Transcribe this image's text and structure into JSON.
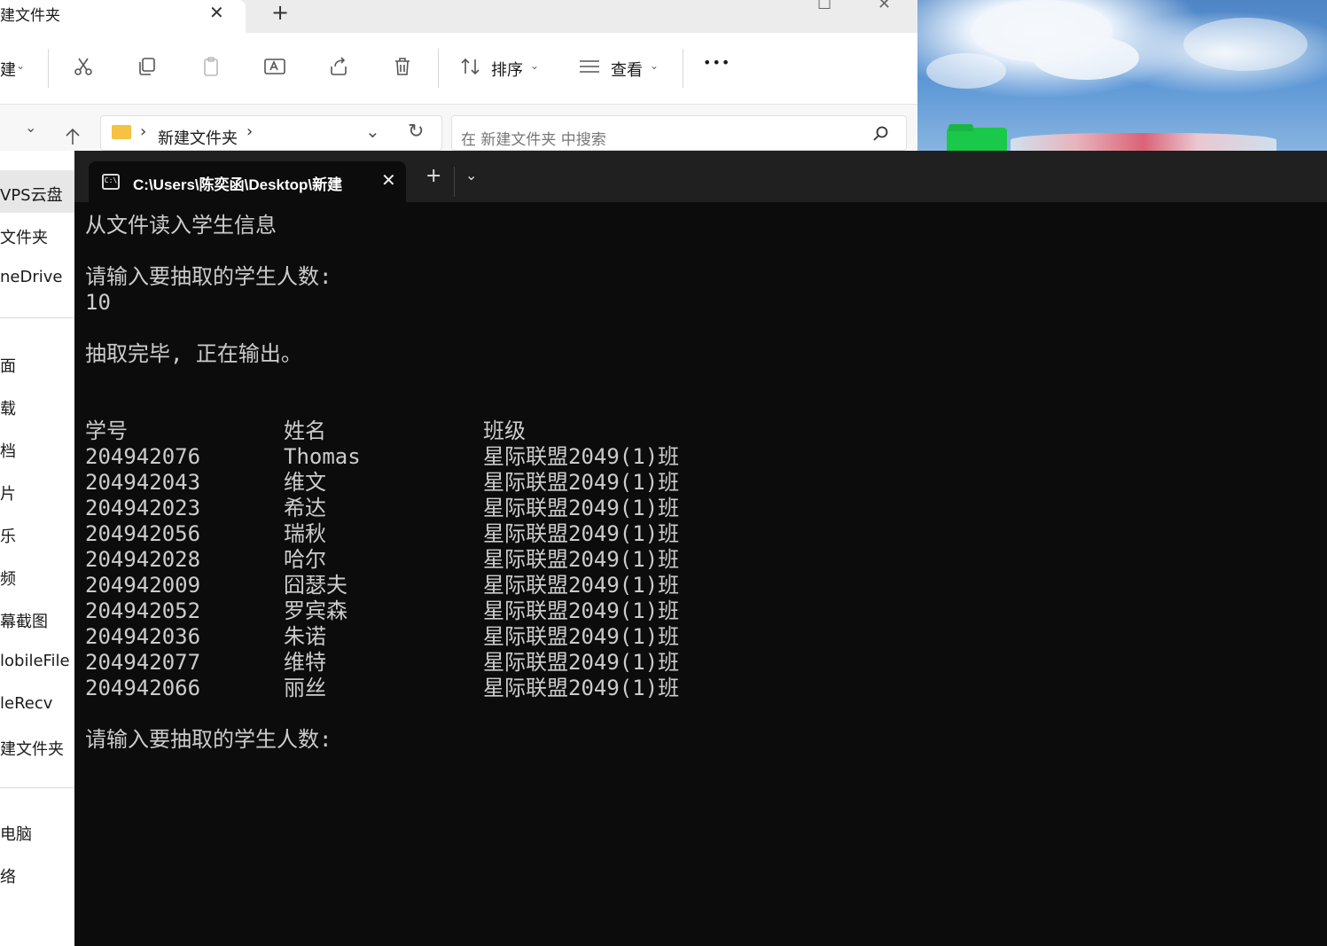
{
  "explorer": {
    "tab_title": "建文件夹",
    "tab_close": "✕",
    "new_tab": "+",
    "toolbar": {
      "new_label": "建",
      "sort_label": "排序",
      "view_label": "查看",
      "more_label": "•••"
    },
    "address": {
      "path_segment": "新建文件夹",
      "separator_1": "›",
      "separator_2": "›"
    },
    "search": {
      "placeholder": "在 新建文件夹 中搜索"
    },
    "sidebar": {
      "items": [
        "VPS云盘",
        "文件夹",
        "neDrive",
        "面",
        "载",
        "档",
        "片",
        "乐",
        "频",
        "幕截图",
        "lobileFile",
        "leRecv",
        "建文件夹",
        "电脑",
        "络"
      ]
    }
  },
  "terminal": {
    "tab_title": "C:\\Users\\陈奕函\\Desktop\\新建",
    "tab_close": "✕",
    "new_tab": "+",
    "dropdown": "⌄",
    "output": {
      "line1": "从文件读入学生信息",
      "prompt1": "请输入要抽取的学生人数:",
      "input1": "10",
      "done": "抽取完毕, 正在输出。",
      "headers": [
        "学号",
        "姓名",
        "班级"
      ],
      "rows": [
        [
          "204942076",
          "Thomas",
          "星际联盟2049(1)班"
        ],
        [
          "204942043",
          "维文",
          "星际联盟2049(1)班"
        ],
        [
          "204942023",
          "希达",
          "星际联盟2049(1)班"
        ],
        [
          "204942056",
          "瑞秋",
          "星际联盟2049(1)班"
        ],
        [
          "204942028",
          "哈尔",
          "星际联盟2049(1)班"
        ],
        [
          "204942009",
          "囧瑟夫",
          "星际联盟2049(1)班"
        ],
        [
          "204942052",
          "罗宾森",
          "星际联盟2049(1)班"
        ],
        [
          "204942036",
          "朱诺",
          "星际联盟2049(1)班"
        ],
        [
          "204942077",
          "维特",
          "星际联盟2049(1)班"
        ],
        [
          "204942066",
          "丽丝",
          "星际联盟2049(1)班"
        ]
      ],
      "prompt2": "请输入要抽取的学生人数:"
    }
  }
}
